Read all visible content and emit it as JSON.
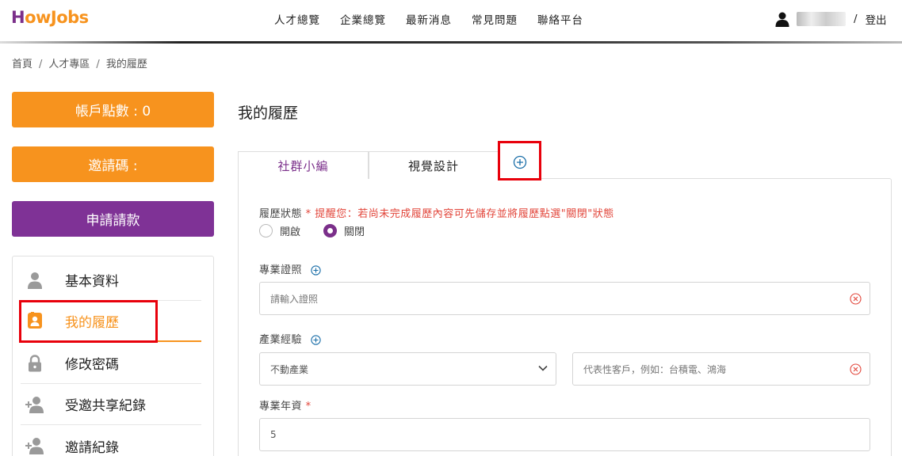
{
  "header": {
    "logo_part1": "H",
    "logo_part2": "ow",
    "logo_part3": "Jobs",
    "nav": [
      "人才總覽",
      "企業總覽",
      "最新消息",
      "常見問題",
      "聯絡平台"
    ],
    "user_slash": "/",
    "logout": "登出"
  },
  "breadcrumb": [
    "首頁",
    "人才專區",
    "我的履歷"
  ],
  "sidebar": {
    "points": "帳戶點數 : 0",
    "invite_code": "邀請碼 :",
    "withdraw": "申請請款",
    "menu": [
      {
        "label": "基本資料",
        "icon": "person-icon"
      },
      {
        "label": "我的履歷",
        "icon": "resume-icon"
      },
      {
        "label": "修改密碼",
        "icon": "lock-icon"
      },
      {
        "label": "受邀共享紀錄",
        "icon": "person-add-icon"
      },
      {
        "label": "邀請紀錄",
        "icon": "person-add-icon"
      }
    ]
  },
  "main": {
    "title": "我的履歷",
    "tabs": [
      "社群小編",
      "視覺設計"
    ],
    "resume_status_label": "履歷狀態",
    "required_mark": "*",
    "resume_status_hint": "提醒您：若尚未完成履歷內容可先儲存並將履歷點選\"關閉\"狀態",
    "radio_open": "開啟",
    "radio_closed": "關閉",
    "selected_status": "關閉",
    "cert_label": "專業證照",
    "cert_placeholder": "請輸入證照",
    "industry_label": "產業經驗",
    "industry_value": "不動產業",
    "client_placeholder": "代表性客戶，例如：台積電、鴻海",
    "years_label": "專業年資",
    "years_value": "5"
  },
  "colors": {
    "brand_purple": "#7b2f8a",
    "brand_orange": "#f7931e",
    "accent_blue": "#1a6ea8",
    "warning_red": "#e2453a",
    "highlight_red": "#e8000b"
  }
}
